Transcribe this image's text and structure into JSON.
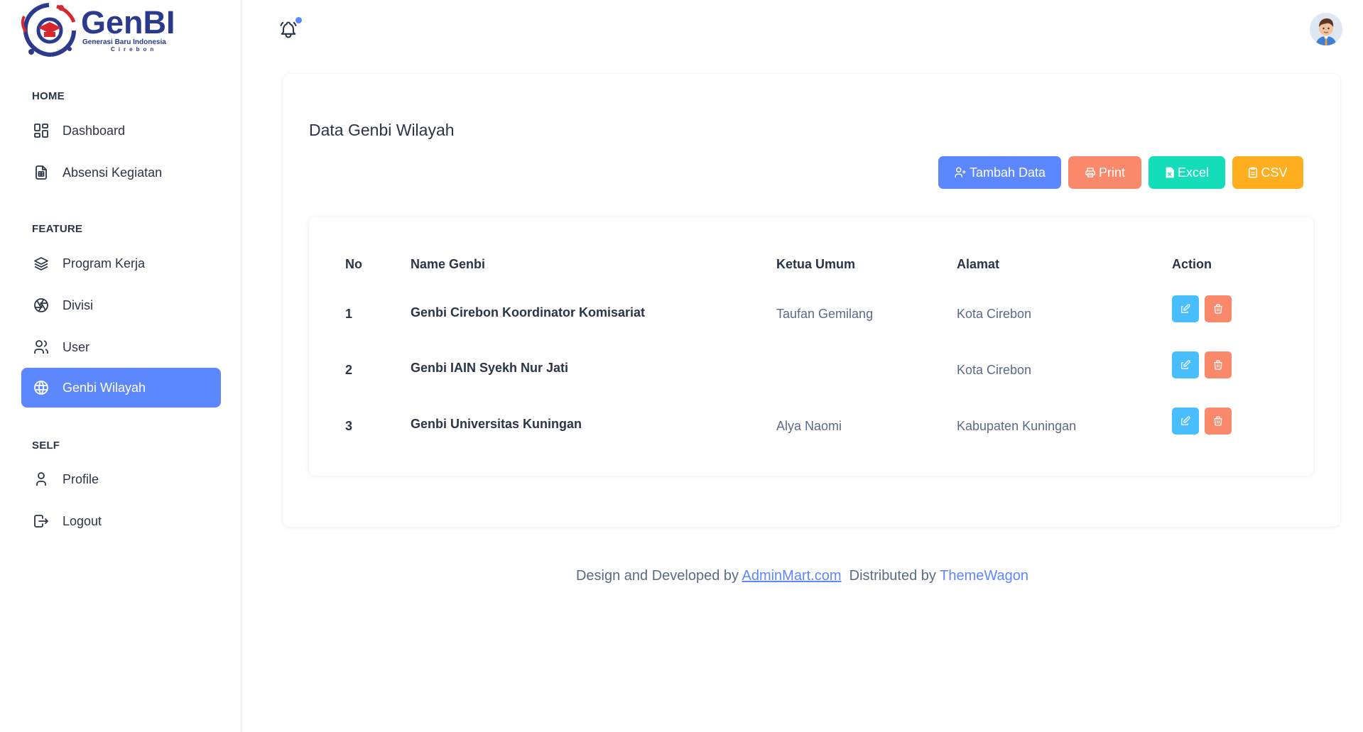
{
  "brand": {
    "logo_word": "GenBI",
    "logo_sub": "Generasi Baru Indonesia",
    "logo_city": "Cirebon"
  },
  "sidebar": {
    "sections": [
      {
        "title": "HOME",
        "items": [
          {
            "label": "Dashboard",
            "icon": "dashboard-icon"
          },
          {
            "label": "Absensi Kegiatan",
            "icon": "file-report-icon"
          }
        ]
      },
      {
        "title": "FEATURE",
        "items": [
          {
            "label": "Program Kerja",
            "icon": "layers-icon"
          },
          {
            "label": "Divisi",
            "icon": "aperture-icon"
          },
          {
            "label": "User",
            "icon": "users-icon"
          },
          {
            "label": "Genbi Wilayah",
            "icon": "world-icon",
            "active": true
          }
        ]
      },
      {
        "title": "SELF",
        "items": [
          {
            "label": "Profile",
            "icon": "user-icon"
          },
          {
            "label": "Logout",
            "icon": "logout-icon"
          }
        ]
      }
    ]
  },
  "header": {
    "notification_icon": "bell-icon",
    "has_notification": true
  },
  "main": {
    "title": "Data Genbi Wilayah",
    "buttons": {
      "add": "Tambah Data",
      "print": "Print",
      "excel": "Excel",
      "csv": "CSV"
    },
    "table": {
      "columns": [
        "No",
        "Name Genbi",
        "Ketua Umum",
        "Alamat",
        "Action"
      ],
      "rows": [
        {
          "no": "1",
          "name": "Genbi Cirebon Koordinator Komisariat",
          "ketua": "Taufan Gemilang",
          "alamat": "Kota Cirebon"
        },
        {
          "no": "2",
          "name": "Genbi IAIN Syekh Nur Jati",
          "ketua": "",
          "alamat": "Kota Cirebon"
        },
        {
          "no": "3",
          "name": "Genbi Universitas Kuningan",
          "ketua": "Alya Naomi",
          "alamat": "Kabupaten Kuningan"
        }
      ]
    }
  },
  "footer": {
    "prefix": "Design and Developed by",
    "link1": "AdminMart.com",
    "middle": "Distributed by",
    "link2": "ThemeWagon"
  },
  "colors": {
    "primary": "#5d87ff",
    "print": "#fa896b",
    "excel": "#13deb9",
    "csv": "#ffae1f",
    "edit": "#49beff",
    "delete": "#fa896b",
    "text": "#2a3547",
    "muted": "#5a6a85"
  }
}
